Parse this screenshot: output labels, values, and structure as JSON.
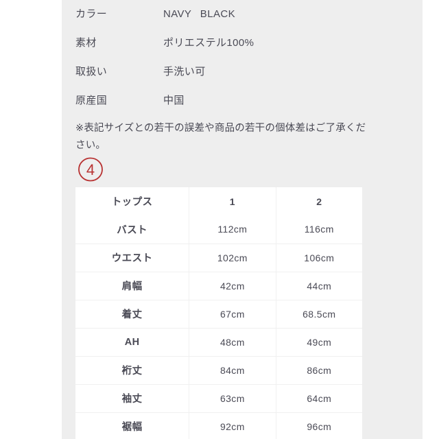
{
  "theme": {
    "page_background": "#ffffff",
    "panel_background": "#eeeeee",
    "text_color": "#4a4a55",
    "table_background": "#ffffff",
    "table_border_color": "#f0f0f0",
    "annotation_color": "#b83232"
  },
  "spec_list": [
    {
      "label": "カラー",
      "value": "NAVY  BLACK"
    },
    {
      "label": "素材",
      "value": "ポリエステル100%"
    },
    {
      "label": "取扱い",
      "value": "手洗い可"
    },
    {
      "label": "原産国",
      "value": "中国"
    }
  ],
  "note": {
    "text": "※表記サイズとの若干の誤差や商品の若干の個体差はご了承ください。"
  },
  "annotation": {
    "number": "4",
    "shape": "circle",
    "color": "#b83232"
  },
  "size_table": {
    "header": {
      "category": "トップス",
      "sizes": [
        "1",
        "2"
      ]
    },
    "rows": [
      {
        "label": "バスト",
        "size_1": "112cm",
        "size_2": "116cm"
      },
      {
        "label": "ウエスト",
        "size_1": "102cm",
        "size_2": "106cm"
      },
      {
        "label": "肩幅",
        "size_1": "42cm",
        "size_2": "44cm"
      },
      {
        "label": "着丈",
        "size_1": "67cm",
        "size_2": "68.5cm"
      },
      {
        "label": "AH",
        "size_1": "48cm",
        "size_2": "49cm"
      },
      {
        "label": "裄丈",
        "size_1": "84cm",
        "size_2": "86cm"
      },
      {
        "label": "袖丈",
        "size_1": "63cm",
        "size_2": "64cm"
      },
      {
        "label": "裾幅",
        "size_1": "92cm",
        "size_2": "96cm"
      }
    ]
  }
}
